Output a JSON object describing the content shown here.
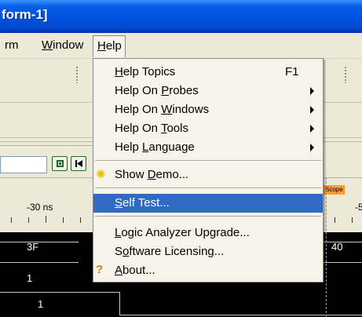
{
  "window": {
    "title": "form-1]"
  },
  "menubar": {
    "form": "rm",
    "window_pre": "",
    "window_hot": "W",
    "window_rest": "indow",
    "help_hot": "H",
    "help_rest": "elp"
  },
  "controls": {
    "button1_icon": "stop-square-icon",
    "button2_icon": "go-to-start-icon"
  },
  "timeline": {
    "left_label": "-30 ns",
    "right_label": "-5",
    "marker": "Scope"
  },
  "waves": {
    "row1_left": "3F",
    "row1_right": "40",
    "row2": "1",
    "row3": "1"
  },
  "help_menu": {
    "items": [
      {
        "pre": "",
        "hot": "H",
        "rest": "elp Topics",
        "accel": "F1"
      },
      {
        "pre": "Help On ",
        "hot": "P",
        "rest": "robes",
        "submenu": true
      },
      {
        "pre": "Help On ",
        "hot": "W",
        "rest": "indows",
        "submenu": true
      },
      {
        "pre": "Help On ",
        "hot": "T",
        "rest": "ools",
        "submenu": true
      },
      {
        "pre": "Help ",
        "hot": "L",
        "rest": "anguage",
        "submenu": true
      },
      {
        "pre": "Show ",
        "hot": "D",
        "rest": "emo...",
        "icon": "lightbulb-icon"
      },
      {
        "pre": "",
        "hot": "S",
        "rest": "elf Test...",
        "selected": true
      },
      {
        "pre": "",
        "hot": "L",
        "rest": "ogic Analyzer Upgrade..."
      },
      {
        "pre": "S",
        "hot": "o",
        "rest": "ftware Licensing..."
      },
      {
        "pre": "",
        "hot": "A",
        "rest": "bout...",
        "icon": "help-question-icon"
      }
    ]
  },
  "colors": {
    "titlebar": "#0054e3",
    "menu_highlight": "#316ac5",
    "scope_marker": "#ff9933"
  }
}
